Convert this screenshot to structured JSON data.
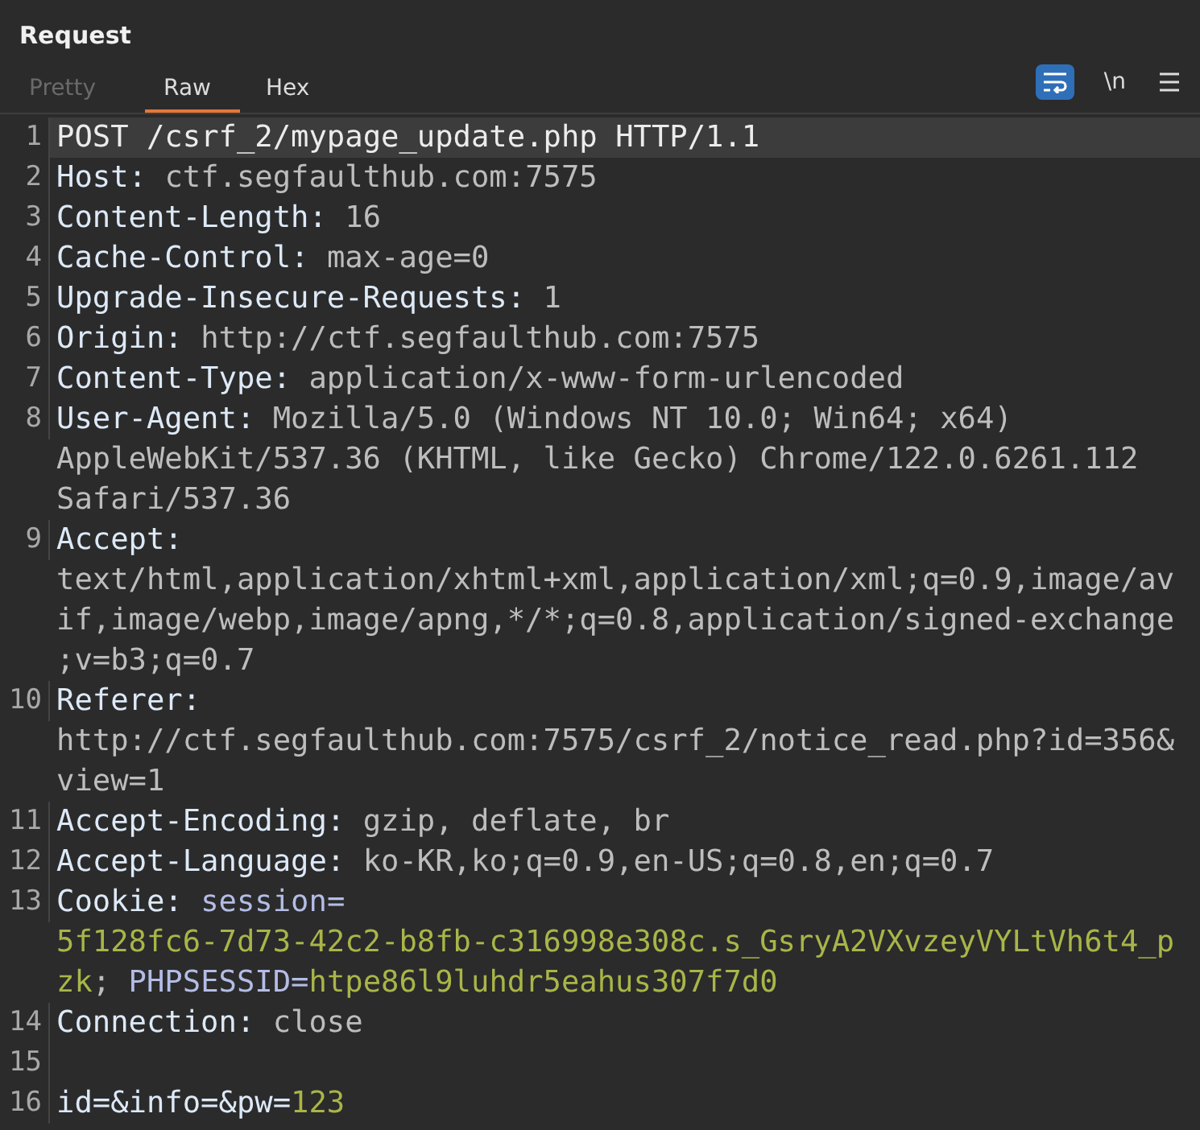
{
  "panel": {
    "title": "Request"
  },
  "tabs": [
    {
      "label": "Pretty",
      "selected": false,
      "disabled": true
    },
    {
      "label": "Raw",
      "selected": true,
      "disabled": false
    },
    {
      "label": "Hex",
      "selected": false,
      "disabled": false
    }
  ],
  "toolbar": {
    "wrap_on": true,
    "newline_label": "\\n"
  },
  "lines": [
    {
      "number": "1",
      "selected": true,
      "segments": [
        {
          "kind": "plain",
          "text": "POST /csrf_2/mypage_update.php HTTP/1.1"
        }
      ]
    },
    {
      "number": "2",
      "selected": false,
      "segments": [
        {
          "kind": "name",
          "text": "Host:"
        },
        {
          "kind": "value",
          "text": " ctf.segfaulthub.com:7575"
        }
      ]
    },
    {
      "number": "3",
      "selected": false,
      "segments": [
        {
          "kind": "name",
          "text": "Content-Length:"
        },
        {
          "kind": "value",
          "text": " 16"
        }
      ]
    },
    {
      "number": "4",
      "selected": false,
      "segments": [
        {
          "kind": "name",
          "text": "Cache-Control:"
        },
        {
          "kind": "value",
          "text": " max-age=0"
        }
      ]
    },
    {
      "number": "5",
      "selected": false,
      "segments": [
        {
          "kind": "name",
          "text": "Upgrade-Insecure-Requests:"
        },
        {
          "kind": "value",
          "text": " 1"
        }
      ]
    },
    {
      "number": "6",
      "selected": false,
      "segments": [
        {
          "kind": "name",
          "text": "Origin:"
        },
        {
          "kind": "value",
          "text": " http://ctf.segfaulthub.com:7575"
        }
      ]
    },
    {
      "number": "7",
      "selected": false,
      "segments": [
        {
          "kind": "name",
          "text": "Content-Type:"
        },
        {
          "kind": "value",
          "text": " application/x-www-form-urlencoded"
        }
      ]
    },
    {
      "number": "8",
      "selected": false,
      "segments": [
        {
          "kind": "name",
          "text": "User-Agent:"
        },
        {
          "kind": "value",
          "text": " Mozilla/5.0 (Windows NT 10.0; Win64; x64) AppleWebKit/537.36 (KHTML, like Gecko) Chrome/122.0.6261.112 Safari/537.36"
        }
      ]
    },
    {
      "number": "9",
      "selected": false,
      "segments": [
        {
          "kind": "name",
          "text": "Accept:"
        },
        {
          "kind": "value",
          "text": " text/html,application/xhtml+xml,application/xml;q=0.9,image/avif,image/webp,image/apng,*/*;q=0.8,application/signed-exchange;v=b3;q=0.7"
        }
      ]
    },
    {
      "number": "10",
      "selected": false,
      "segments": [
        {
          "kind": "name",
          "text": "Referer:"
        },
        {
          "kind": "value",
          "text": " http://ctf.segfaulthub.com:7575/csrf_2/notice_read.php?id=356&"
        },
        {
          "kind": "value",
          "text": "view=1"
        }
      ]
    },
    {
      "number": "11",
      "selected": false,
      "segments": [
        {
          "kind": "name",
          "text": "Accept-Encoding:"
        },
        {
          "kind": "value",
          "text": " gzip, deflate, br"
        }
      ]
    },
    {
      "number": "12",
      "selected": false,
      "segments": [
        {
          "kind": "name",
          "text": "Accept-Language:"
        },
        {
          "kind": "value",
          "text": " ko-KR,ko;q=0.9,en-US;q=0.8,en;q=0.7"
        }
      ]
    },
    {
      "number": "13",
      "selected": false,
      "segments": [
        {
          "kind": "name",
          "text": "Cookie:"
        },
        {
          "kind": "cookie-name",
          "text": " session="
        },
        {
          "kind": "cookie-value",
          "text": "5f128fc6-7d73-42c2-b8fb-c316998e308c.s_GsryA2VXvzeyVYLtVh6t4_pzk"
        },
        {
          "kind": "value",
          "text": "; "
        },
        {
          "kind": "cookie-name",
          "text": "PHPSESSID="
        },
        {
          "kind": "cookie-value",
          "text": "htpe86l9luhdr5eahus307f7d0"
        }
      ]
    },
    {
      "number": "14",
      "selected": false,
      "segments": [
        {
          "kind": "name",
          "text": "Connection:"
        },
        {
          "kind": "value",
          "text": " close"
        }
      ]
    },
    {
      "number": "15",
      "selected": false
    },
    {
      "number": "16",
      "selected": false,
      "segments": [
        {
          "kind": "name",
          "text": "id=&info=&pw="
        },
        {
          "kind": "cookie-value",
          "text": "123"
        }
      ]
    }
  ]
}
